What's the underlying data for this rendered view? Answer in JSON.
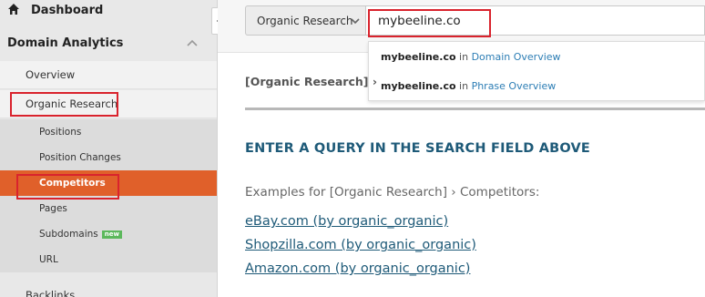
{
  "sidebar": {
    "dashboard_label": "Dashboard",
    "section_label": "Domain Analytics",
    "items": [
      {
        "label": "Overview"
      },
      {
        "label": "Organic Research"
      }
    ],
    "sub_items": [
      {
        "label": "Positions"
      },
      {
        "label": "Position Changes"
      },
      {
        "label": "Competitors"
      },
      {
        "label": "Pages"
      },
      {
        "label": "Subdomains",
        "badge": "new"
      },
      {
        "label": "URL"
      }
    ],
    "backlinks_label": "Backlinks"
  },
  "search": {
    "database": "Organic Research",
    "query": "mybeeline.co",
    "suggestions": [
      {
        "query": "mybeeline.co",
        "connector": "in",
        "target": "Domain Overview"
      },
      {
        "query": "mybeeline.co",
        "connector": "in",
        "target": "Phrase Overview"
      }
    ]
  },
  "main": {
    "breadcrumb": "[Organic Research] ›",
    "heading": "ENTER A QUERY IN THE SEARCH FIELD ABOVE",
    "examples_label": "Examples for [Organic Research] › Competitors:",
    "examples": [
      "eBay.com (by organic_organic)",
      "Shopzilla.com (by organic_organic)",
      "Amazon.com (by organic_organic)"
    ]
  },
  "colors": {
    "accent_active": "#e0602a",
    "heading": "#1e5a78",
    "link_blue": "#2d7eb5",
    "highlight_box": "#d9232d",
    "new_badge": "#5cb85c"
  },
  "icons": [
    "home-icon",
    "chevron-up-icon",
    "chevron-left-icon",
    "chevron-down-icon"
  ]
}
